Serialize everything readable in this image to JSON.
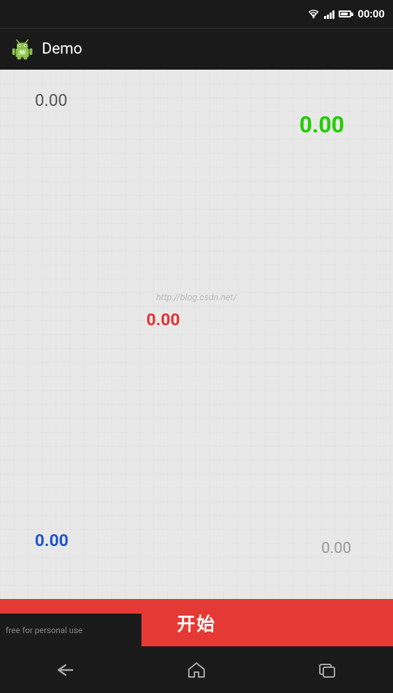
{
  "status_bar": {
    "time": "00:00",
    "wifi_label": "wifi",
    "signal_label": "signal",
    "battery_label": "battery"
  },
  "action_bar": {
    "title": "Demo"
  },
  "main": {
    "value_top_left": "0.00",
    "value_top_right": "0.00",
    "watermark": "http://blog.csdn.net/",
    "value_center": "0.00",
    "value_bottom_left": "0.00",
    "value_bottom_right": "0.00"
  },
  "start_button": {
    "label": "开始"
  },
  "nav_bar": {
    "back_label": "back",
    "home_label": "home",
    "recent_label": "recent"
  },
  "footer": {
    "free_text": "free for personal use"
  }
}
